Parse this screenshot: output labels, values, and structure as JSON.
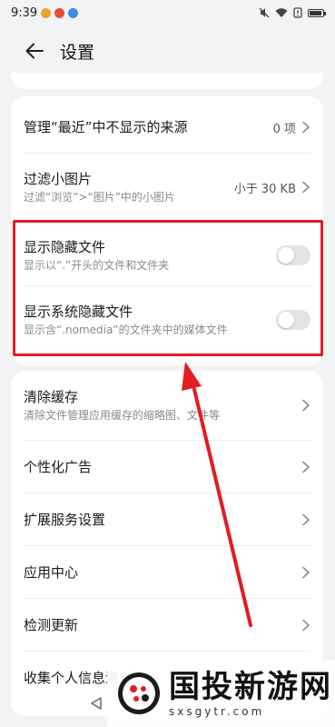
{
  "status_bar": {
    "time": "9:39",
    "battery_level": 0.9,
    "icons": [
      "notification-icon",
      "notification-icon",
      "app-icon",
      "mute-icon",
      "wifi-icon",
      "sim-icon",
      "battery-icon"
    ]
  },
  "header": {
    "title": "设置"
  },
  "settings_top": {
    "items": [
      {
        "title": "管理“最近”中不显示的来源",
        "value": "0 项"
      },
      {
        "title": "过滤小图片",
        "subtitle": "过滤“浏览”>“图片”中的小图片",
        "value": "小于 30 KB"
      },
      {
        "title": "显示隐藏文件",
        "subtitle": "显示以“.”开头的文件和文件夹",
        "toggle": false
      },
      {
        "title": "显示系统隐藏文件",
        "subtitle": "显示含“.nomedia”的文件夹中的媒体文件",
        "toggle": false
      }
    ]
  },
  "settings_bottom": {
    "items": [
      {
        "title": "清除缓存",
        "subtitle": "清除文件管理应用缓存的缩略图、文件等"
      },
      {
        "title": "个性化广告"
      },
      {
        "title": "扩展服务设置"
      },
      {
        "title": "应用中心"
      },
      {
        "title": "检测更新"
      },
      {
        "title": "收集个人信息清单"
      }
    ]
  },
  "watermark": {
    "title": "国投新游网",
    "url": "sxsgytr.com"
  },
  "colors": {
    "highlight": "#e31b23",
    "background": "#f1f3f5",
    "card": "#ffffff"
  }
}
